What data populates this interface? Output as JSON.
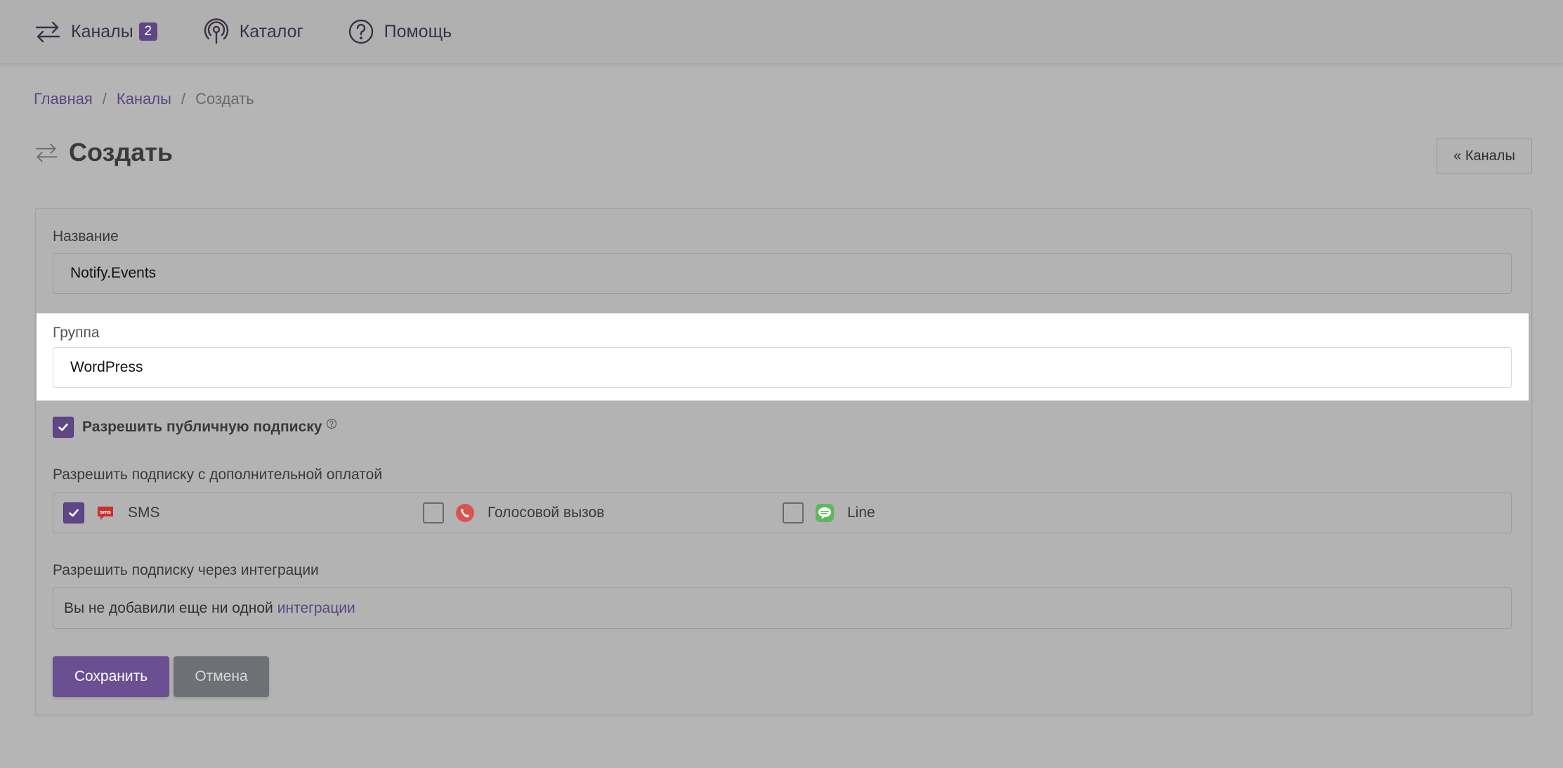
{
  "nav": {
    "channels_label": "Каналы",
    "channels_count": "2",
    "catalog_label": "Каталог",
    "help_label": "Помощь"
  },
  "breadcrumb": {
    "home": "Главная",
    "channels": "Каналы",
    "current": "Создать"
  },
  "page": {
    "title": "Создать",
    "back_button": "« Каналы"
  },
  "form": {
    "name_label": "Название",
    "name_value": "Notify.Events",
    "group_label": "Группа",
    "group_value": "WordPress",
    "public_subscribe_label": "Разрешить публичную подписку",
    "public_subscribe_checked": true,
    "paid_label": "Разрешить подписку с дополнительной оплатой",
    "paid_options": [
      {
        "label": "SMS",
        "checked": true,
        "icon": "sms-icon"
      },
      {
        "label": "Голосовой вызов",
        "checked": false,
        "icon": "phone-call-icon"
      },
      {
        "label": "Line",
        "checked": false,
        "icon": "line-app-icon"
      }
    ],
    "integrations_label": "Разрешить подписку через интеграции",
    "integrations_text": "Вы не добавили еще ни одной",
    "integrations_link": "интеграции",
    "save_button": "Сохранить",
    "cancel_button": "Отмена"
  },
  "colors": {
    "accent": "#5e4784",
    "link": "#5c4684",
    "sms_icon": "#c9302c",
    "voice_icon": "#d9534f",
    "line_icon": "#5cb85c"
  }
}
